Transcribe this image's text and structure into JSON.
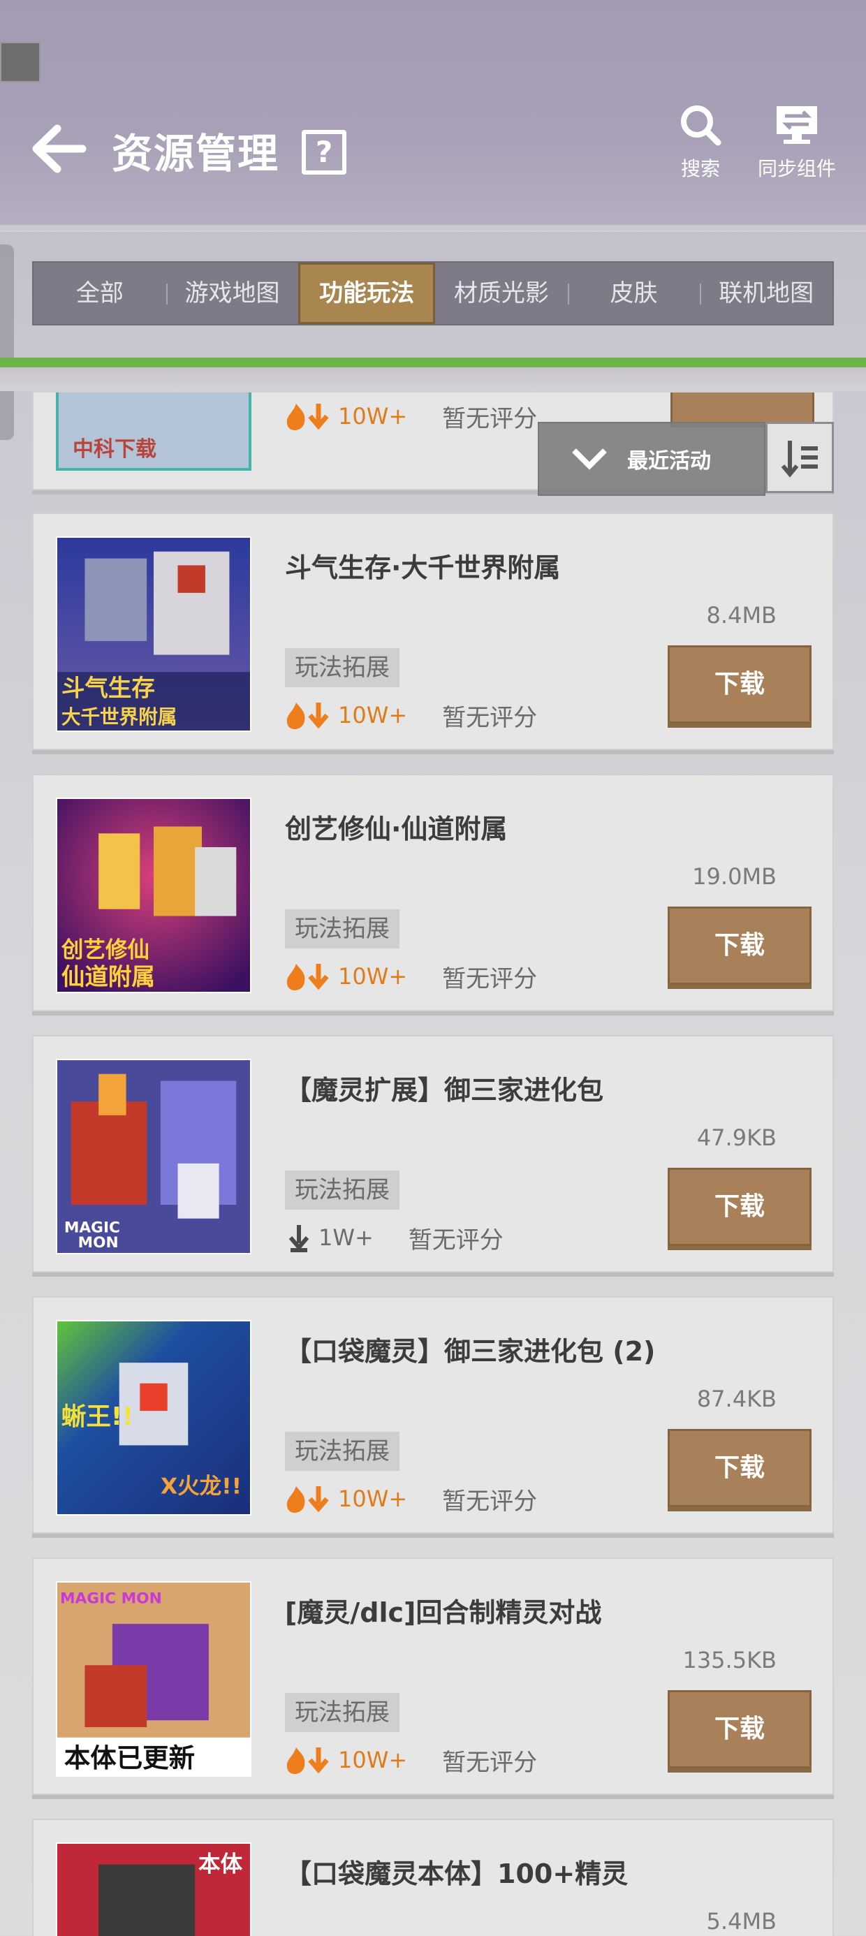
{
  "header": {
    "title": "资源管理",
    "help_label": "?",
    "search_label": "搜索",
    "sync_label": "同步组件"
  },
  "tabs": [
    {
      "label": "全部",
      "active": false
    },
    {
      "label": "游戏地图",
      "active": false
    },
    {
      "label": "功能玩法",
      "active": true
    },
    {
      "label": "材质光影",
      "active": false
    },
    {
      "label": "皮肤",
      "active": false
    },
    {
      "label": "联机地图",
      "active": false
    }
  ],
  "sort": {
    "label": "最近活动"
  },
  "partial_item": {
    "thumb_text": "中科下载",
    "downloads": "10W+",
    "rating": "暂无评分"
  },
  "items": [
    {
      "name": "斗气生存·大千世界附属",
      "size": "8.4MB",
      "tag": "玩法拓展",
      "downloads": "10W+",
      "hot": true,
      "rating": "暂无评分",
      "button": "下载",
      "thumb_text": [
        "斗气生存",
        "大千世界附属"
      ],
      "colors": [
        "#2c3a9c",
        "#b8a6e0"
      ]
    },
    {
      "name": "创艺修仙·仙道附属",
      "size": "19.0MB",
      "tag": "玩法拓展",
      "downloads": "10W+",
      "hot": true,
      "rating": "暂无评分",
      "button": "下载",
      "thumb_text": [
        "创艺修仙",
        "仙道附属"
      ],
      "colors": [
        "#4a1a6a",
        "#d8407a"
      ]
    },
    {
      "name": "【魔灵扩展】御三家进化包",
      "size": "47.9KB",
      "tag": "玩法拓展",
      "downloads": "1W+",
      "hot": false,
      "rating": "暂无评分",
      "button": "下载",
      "thumb_text": [
        "MAGIC",
        "MON"
      ],
      "colors": [
        "#3a3a8a",
        "#c33a2a"
      ]
    },
    {
      "name": "【口袋魔灵】御三家进化包 (2)",
      "size": "87.4KB",
      "tag": "玩法拓展",
      "downloads": "10W+",
      "hot": true,
      "rating": "暂无评分",
      "button": "下载",
      "thumb_text": [
        "蜥王!!",
        "X火龙!!"
      ],
      "colors": [
        "#1f4fa0",
        "#62c43a"
      ]
    },
    {
      "name": "[魔灵/dlc]回合制精灵对战",
      "size": "135.5KB",
      "tag": "玩法拓展",
      "downloads": "10W+",
      "hot": true,
      "rating": "暂无评分",
      "button": "下载",
      "thumb_text": [
        "MAGIC MON",
        "本体已更新"
      ],
      "colors": [
        "#d9a56e",
        "#7a3aa8"
      ]
    },
    {
      "name": "【口袋魔灵本体】100+精灵",
      "size": "5.4MB",
      "tag": "",
      "downloads": "",
      "hot": false,
      "rating": "",
      "button": "",
      "thumb_text": [
        "本体",
        ""
      ],
      "colors": [
        "#c0283a",
        "#3a3a3a"
      ]
    }
  ],
  "colors": {
    "accent_gold": "#a9854f",
    "download_orange": "#e07b1a",
    "green_bar": "#6cb44a"
  }
}
